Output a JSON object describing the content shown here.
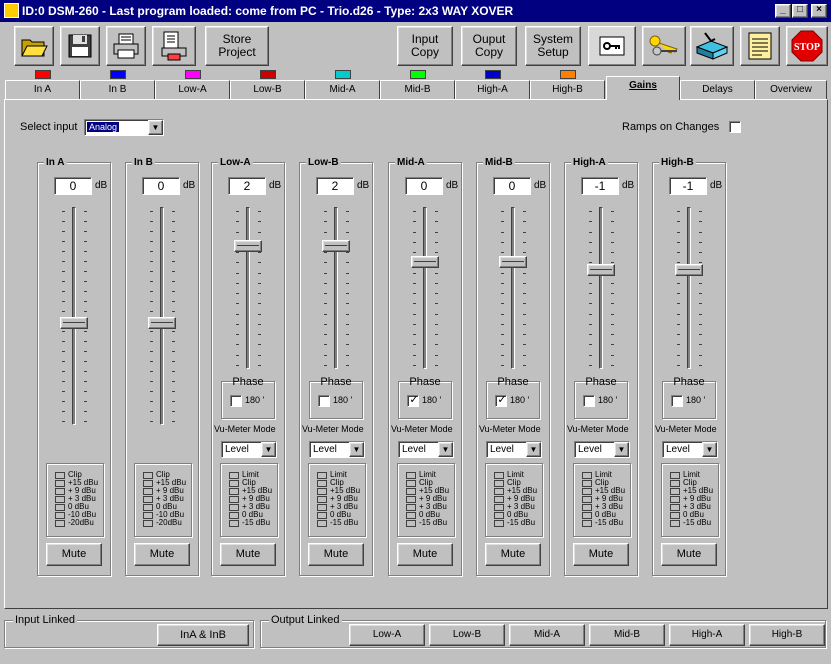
{
  "window": {
    "title": "ID:0 DSM-260 - Last program loaded: come from PC - Trio.d26 - Type: 2x3 WAY XOVER",
    "min": "_",
    "max": "□",
    "close": "×"
  },
  "toolbar": {
    "store_project": "Store\nProject",
    "input_copy": "Input\nCopy",
    "output_copy": "Ouput\nCopy",
    "system_setup": "System\nSetup",
    "stop_label": "STOP"
  },
  "tabs": [
    {
      "label": "In A",
      "color": "#ff0000"
    },
    {
      "label": "In B",
      "color": "#0000ff"
    },
    {
      "label": "Low-A",
      "color": "#ff00ff"
    },
    {
      "label": "Low-B",
      "color": "#cc0000"
    },
    {
      "label": "Mid-A",
      "color": "#00cccc"
    },
    {
      "label": "Mid-B",
      "color": "#00ff00"
    },
    {
      "label": "High-A",
      "color": "#0000cc"
    },
    {
      "label": "High-B",
      "color": "#ff8000"
    },
    {
      "label": "Gains",
      "color": null
    },
    {
      "label": "Delays",
      "color": null
    },
    {
      "label": "Overview",
      "color": null
    }
  ],
  "active_tab": "Gains",
  "select_input": {
    "label": "Select input",
    "value": "Analog"
  },
  "ramps": {
    "label": "Ramps on Changes",
    "checked": false
  },
  "common": {
    "db": "dB",
    "phase": "Phase",
    "phase_180": "180 '",
    "vu_mode": "Vu-Meter Mode",
    "vu_value": "Level",
    "mute": "Mute"
  },
  "input_meter_labels": [
    "Clip",
    "+15 dBu",
    "+ 9 dBu",
    "+ 3 dBu",
    "0 dBu",
    "-10 dBu",
    "-20dBu"
  ],
  "output_meter_labels": [
    "Limit",
    "Clip",
    "+15 dBu",
    "+ 9 dBu",
    "+ 3 dBu",
    "0 dBu",
    "-15 dBu"
  ],
  "channels": [
    {
      "name": "In A",
      "gain": "0",
      "fader_level": 0.47,
      "type": "input"
    },
    {
      "name": "In B",
      "gain": "0",
      "fader_level": 0.47,
      "type": "input"
    },
    {
      "name": "Low-A",
      "gain": "2",
      "fader_level": 0.76,
      "type": "output",
      "phase_180": false
    },
    {
      "name": "Low-B",
      "gain": "2",
      "fader_level": 0.76,
      "type": "output",
      "phase_180": false
    },
    {
      "name": "Mid-A",
      "gain": "0",
      "fader_level": 0.66,
      "type": "output",
      "phase_180": true
    },
    {
      "name": "Mid-B",
      "gain": "0",
      "fader_level": 0.66,
      "type": "output",
      "phase_180": true
    },
    {
      "name": "High-A",
      "gain": "-1",
      "fader_level": 0.61,
      "type": "output",
      "phase_180": false
    },
    {
      "name": "High-B",
      "gain": "-1",
      "fader_level": 0.61,
      "type": "output",
      "phase_180": false
    }
  ],
  "input_linked": {
    "label": "Input Linked",
    "button": "InA & InB"
  },
  "output_linked": {
    "label": "Output Linked",
    "buttons": [
      "Low-A",
      "Low-B",
      "Mid-A",
      "Mid-B",
      "High-A",
      "High-B"
    ]
  }
}
